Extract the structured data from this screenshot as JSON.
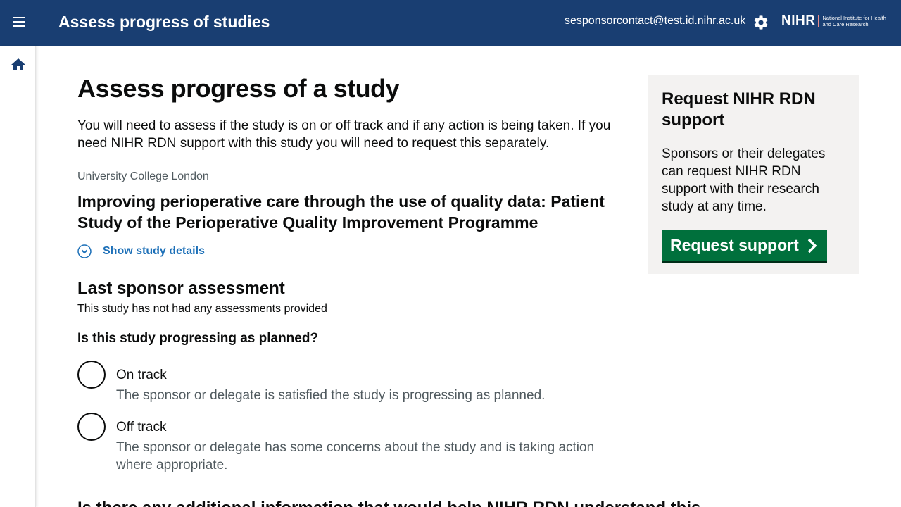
{
  "header": {
    "app_title": "Assess progress of studies",
    "user_email": "sesponsorcontact@test.id.nihr.ac.uk",
    "logo_text": "NIHR",
    "logo_subtext": "National Institute for Health and Care Research",
    "background_color": "#193e72"
  },
  "icons": {
    "menu": "hamburger-icon",
    "settings": "gear-icon",
    "home": "home-icon",
    "details": "chevron-down-circle-icon",
    "button": "chevron-right-icon"
  },
  "main": {
    "page_title": "Assess progress of a study",
    "intro": "You will need to assess if the study is on or off track and if any action is being taken. If you need NIHR RDN support with this study you will need to request this separately.",
    "organisation": "University College London",
    "study_title": "Improving perioperative care through the use of quality data: Patient Study of the Perioperative Quality Improvement Programme",
    "details_link": "Show study details",
    "last_assessment": {
      "title": "Last sponsor assessment",
      "text": "This study has not had any assessments provided"
    },
    "question": "Is this study progressing as planned?",
    "options": [
      {
        "label": "On track",
        "hint": "The sponsor or delegate is satisfied the study is progressing as planned."
      },
      {
        "label": "Off track",
        "hint": "The sponsor or delegate has some concerns about the study and is taking action where appropriate."
      }
    ],
    "next_question": "Is there any additional information that would help NIHR RDN understand this"
  },
  "side_panel": {
    "title": "Request NIHR RDN support",
    "text": "Sponsors or their delegates can request NIHR RDN support with their research study at any time.",
    "button_label": "Request support",
    "button_color": "#00703c"
  }
}
